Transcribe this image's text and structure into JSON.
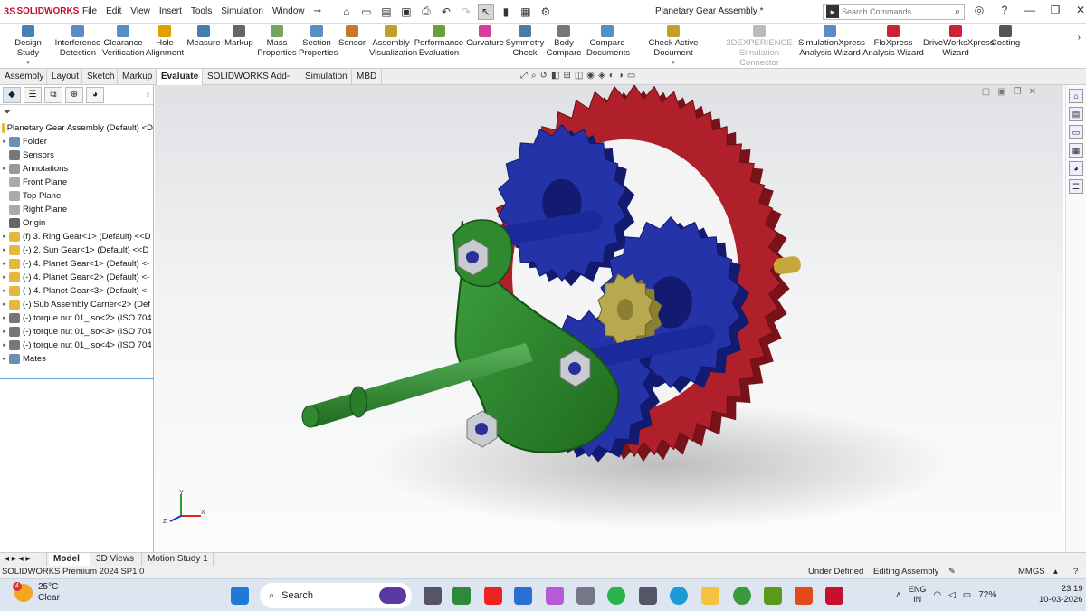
{
  "app": {
    "name": "SOLIDWORKS",
    "doc_title": "Planetary Gear Assembly *"
  },
  "menu": [
    "File",
    "Edit",
    "View",
    "Insert",
    "Tools",
    "Simulation",
    "Window"
  ],
  "search": {
    "placeholder": "Search Commands"
  },
  "commands": [
    {
      "label": "Design Study",
      "icon": "design-study-icon",
      "color": "#4a7fb5"
    },
    {
      "label": "Interference Detection",
      "icon": "interference-icon",
      "color": "#5b8cc4"
    },
    {
      "label": "Clearance Verification",
      "icon": "clearance-icon",
      "color": "#5b8cc4"
    },
    {
      "label": "Hole Alignment",
      "icon": "hole-icon",
      "color": "#e0a000"
    },
    {
      "label": "Measure",
      "icon": "measure-icon",
      "color": "#4b7ba8"
    },
    {
      "label": "Markup",
      "icon": "markup-icon",
      "color": "#666"
    },
    {
      "label": "Mass Properties",
      "icon": "mass-icon",
      "color": "#7ba35c"
    },
    {
      "label": "Section Properties",
      "icon": "section-icon",
      "color": "#5b8cc4"
    },
    {
      "label": "Sensor",
      "icon": "sensor-icon",
      "color": "#c47a2b"
    },
    {
      "label": "Assembly Visualization",
      "icon": "asmviz-icon",
      "color": "#c4a02b"
    },
    {
      "label": "Performance Evaluation",
      "icon": "performance-icon",
      "color": "#6a9f3c"
    },
    {
      "label": "Curvature",
      "icon": "curvature-icon",
      "color": "#d33f9a"
    },
    {
      "label": "Symmetry Check",
      "icon": "symmetry-icon",
      "color": "#4b7ba8"
    },
    {
      "label": "Body Compare",
      "icon": "body-compare-icon",
      "color": "#777"
    },
    {
      "label": "Compare Documents",
      "icon": "compare-icon",
      "color": "#5b8cc4"
    },
    {
      "label": "Check Active Document",
      "icon": "check-icon",
      "color": "#c4a02b"
    },
    {
      "label": "3DEXPERIENCE Simulation Connector",
      "icon": "3dx-icon",
      "color": "#bbb"
    },
    {
      "label": "SimulationXpress Analysis Wizard",
      "icon": "simxpress-icon",
      "color": "#5b8cc4"
    },
    {
      "label": "FloXpress Analysis Wizard",
      "icon": "floxpress-icon",
      "color": "#c23"
    },
    {
      "label": "DriveWorksXpress Wizard",
      "icon": "driveworks-icon",
      "color": "#c23"
    },
    {
      "label": "Costing",
      "icon": "costing-icon",
      "color": "#555"
    }
  ],
  "tabs": [
    "Assembly",
    "Layout",
    "Sketch",
    "Markup",
    "Evaluate",
    "SOLIDWORKS Add-Ins",
    "Simulation",
    "MBD"
  ],
  "active_tab": "Evaluate",
  "tree": {
    "root": "Planetary Gear Assembly (Default) <D",
    "items": [
      {
        "label": "Folder",
        "icon": "folder-icon",
        "color": "#6b8fb5",
        "expand": true
      },
      {
        "label": "Sensors",
        "icon": "sensor-icon",
        "color": "#777",
        "expand": false
      },
      {
        "label": "Annotations",
        "icon": "annotation-icon",
        "color": "#999",
        "expand": true
      },
      {
        "label": "Front Plane",
        "icon": "plane-icon",
        "color": "#aaa",
        "expand": false
      },
      {
        "label": "Top Plane",
        "icon": "plane-icon",
        "color": "#aaa",
        "expand": false
      },
      {
        "label": "Right Plane",
        "icon": "plane-icon",
        "color": "#aaa",
        "expand": false
      },
      {
        "label": "Origin",
        "icon": "origin-icon",
        "color": "#666",
        "expand": false
      },
      {
        "label": "(f) 3. Ring Gear<1> (Default) <<D",
        "icon": "part-icon",
        "color": "#e6b83a",
        "expand": true
      },
      {
        "label": "(-) 2. Sun Gear<1> (Default) <<D",
        "icon": "part-icon",
        "color": "#e6b83a",
        "expand": true
      },
      {
        "label": "(-) 4. Planet Gear<1> (Default) <-",
        "icon": "part-icon",
        "color": "#e6b83a",
        "expand": true
      },
      {
        "label": "(-) 4. Planet Gear<2> (Default) <-",
        "icon": "part-icon",
        "color": "#e6b83a",
        "expand": true
      },
      {
        "label": "(-) 4. Planet Gear<3> (Default) <-",
        "icon": "part-icon",
        "color": "#e6b83a",
        "expand": true
      },
      {
        "label": "(-) Sub Assembly Carrier<2> (Def",
        "icon": "subassembly-icon",
        "color": "#e6b83a",
        "expand": true
      },
      {
        "label": "(-) torque nut 01_iso<2> (ISO 704",
        "icon": "nut-icon",
        "color": "#777",
        "expand": true
      },
      {
        "label": "(-) torque nut 01_iso<3> (ISO 704",
        "icon": "nut-icon",
        "color": "#777",
        "expand": true
      },
      {
        "label": "(-) torque nut 01_iso<4> (ISO 704",
        "icon": "nut-icon",
        "color": "#777",
        "expand": true
      },
      {
        "label": "Mates",
        "icon": "mates-icon",
        "color": "#6b8fb5",
        "expand": true
      }
    ]
  },
  "bottom_tabs": [
    "Model",
    "3D Views",
    "Motion Study 1"
  ],
  "status": {
    "version": "SOLIDWORKS Premium 2024 SP1.0",
    "state": "Under Defined",
    "mode": "Editing Assembly",
    "units": "MMGS"
  },
  "taskbar": {
    "weather_temp": "25°C",
    "weather_desc": "Clear",
    "weather_badge": "4",
    "search": "Search",
    "lang": "ENG",
    "region": "IN",
    "battery": "72%",
    "time": "23:19",
    "date": "10-03-2026"
  },
  "triad": {
    "x": "X",
    "y": "Y",
    "z": "Z"
  },
  "colors": {
    "ring": "#b0202a",
    "planet": "#2434a8",
    "sun": "#b8a850",
    "carrier": "#2f8a2f",
    "shaft": "#1a2a9a"
  }
}
